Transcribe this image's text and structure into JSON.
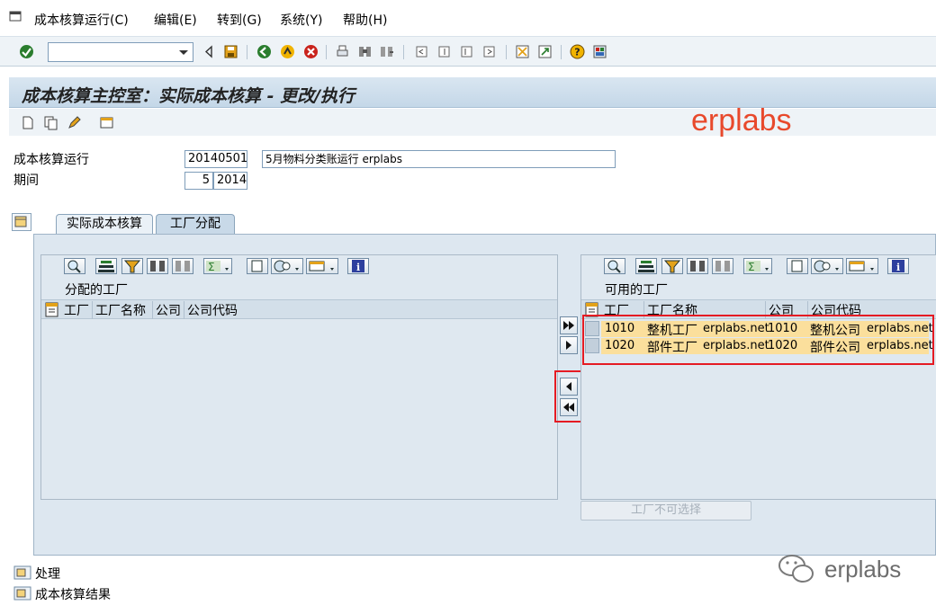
{
  "menu": {
    "items": [
      "成本核算运行(C)",
      "编辑(E)",
      "转到(G)",
      "系统(Y)",
      "帮助(H)"
    ]
  },
  "toolbar": {
    "command_value": ""
  },
  "title": "成本核算主控室：实际成本核算 - 更改/执行",
  "watermark": "erplabs",
  "form": {
    "run_label": "成本核算运行",
    "run_value": "20140501",
    "run_desc": "5月物料分类账运行 erplabs",
    "period_label": "期间",
    "period_value": "5",
    "year_value": "2014"
  },
  "tabs": [
    {
      "label": "实际成本核算"
    },
    {
      "label": "工厂分配"
    }
  ],
  "left_grid": {
    "title": "分配的工厂",
    "columns": [
      "工厂",
      "工厂名称",
      "公司",
      "公司代码"
    ]
  },
  "right_grid": {
    "title": "可用的工厂",
    "columns": [
      "工厂",
      "工厂名称",
      "公司",
      "公司代码"
    ],
    "rows": [
      {
        "plant": "1010",
        "plant_name_cn": "整机工厂",
        "plant_name_en": "erplabs.net",
        "company": "1010",
        "company_name_cn": "整机公司",
        "company_name_en": "erplabs.net"
      },
      {
        "plant": "1020",
        "plant_name_cn": "部件工厂",
        "plant_name_en": "erplabs.net",
        "company": "1020",
        "company_name_cn": "部件公司",
        "company_name_en": "erplabs.net"
      }
    ]
  },
  "buttons": {
    "disabled_label": "工厂不可选择"
  },
  "tree": {
    "items": [
      "处理",
      "成本核算结果"
    ]
  },
  "footer_watermark": "erplabs",
  "colors": {
    "highlight_red": "#e51b23",
    "row_yellow": "#fbdf9c",
    "watermark_orange": "#e8492c"
  }
}
